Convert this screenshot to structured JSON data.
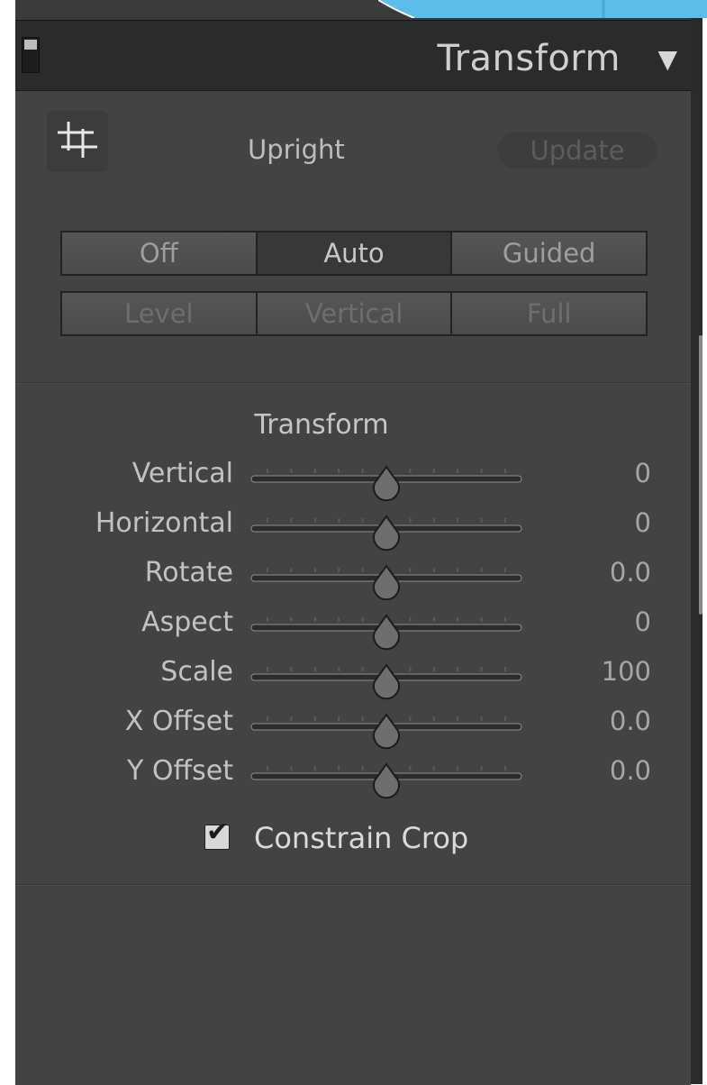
{
  "header": {
    "title": "Transform",
    "collapse_icon": "triangle-down-icon"
  },
  "upright": {
    "tool_icon": "crop-grid-icon",
    "label": "Upright",
    "update_label": "Update",
    "modes_row1": [
      {
        "label": "Off",
        "state": "enabled"
      },
      {
        "label": "Auto",
        "state": "active"
      },
      {
        "label": "Guided",
        "state": "enabled"
      }
    ],
    "modes_row2": [
      {
        "label": "Level",
        "state": "disabled"
      },
      {
        "label": "Vertical",
        "state": "disabled"
      },
      {
        "label": "Full",
        "state": "disabled"
      }
    ]
  },
  "transform": {
    "title": "Transform",
    "sliders": [
      {
        "label": "Vertical",
        "value": "0",
        "position": 0.5
      },
      {
        "label": "Horizontal",
        "value": "0",
        "position": 0.5
      },
      {
        "label": "Rotate",
        "value": "0.0",
        "position": 0.5
      },
      {
        "label": "Aspect",
        "value": "0",
        "position": 0.5
      },
      {
        "label": "Scale",
        "value": "100",
        "position": 0.5
      },
      {
        "label": "X Offset",
        "value": "0.0",
        "position": 0.5
      },
      {
        "label": "Y Offset",
        "value": "0.0",
        "position": 0.5
      }
    ],
    "constrain_crop": {
      "label": "Constrain Crop",
      "checked": true
    }
  },
  "colors": {
    "panel_bg": "#434343",
    "header_bg": "#2b2b2b",
    "text": "#c2c2c2",
    "accent_blue": "#4fb3e3"
  }
}
